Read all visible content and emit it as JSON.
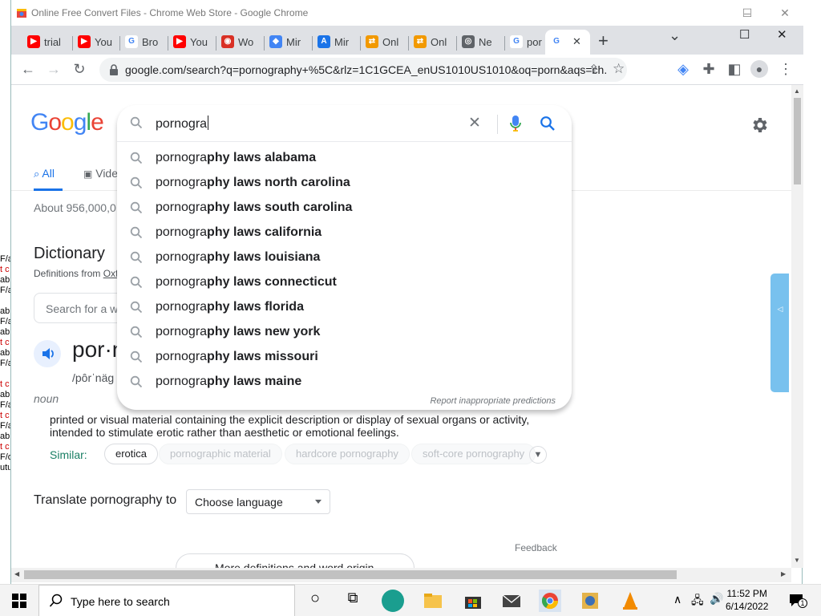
{
  "desktop_left_fragments": [
    "F/a",
    "t c",
    "abl",
    "F/a",
    "abl",
    "F/a",
    "abl",
    "t c",
    "abl",
    "F/a",
    "t c",
    "abl",
    "F/a",
    "t c",
    "F/a",
    "abl",
    "t c",
    "F/o",
    "utu"
  ],
  "window": {
    "title": "Online Free Convert Files - Chrome Web Store - Google Chrome",
    "minimize": "–",
    "maximize": "☐",
    "close": "✕"
  },
  "tabs": [
    {
      "label": "trial",
      "favicon": "youtube-icon",
      "color": "#ff0000",
      "glyph": "▶"
    },
    {
      "label": "You",
      "favicon": "youtube-icon",
      "color": "#ff0000",
      "glyph": "▶"
    },
    {
      "label": "Bro",
      "favicon": "google-icon",
      "color": "#ffffff",
      "glyph": "G"
    },
    {
      "label": "You",
      "favicon": "youtube-icon",
      "color": "#ff0000",
      "glyph": "▶"
    },
    {
      "label": "Wo",
      "favicon": "owl-icon",
      "color": "#d93025",
      "glyph": "◉"
    },
    {
      "label": "Mir",
      "favicon": "app-icon",
      "color": "#4285f4",
      "glyph": "◆"
    },
    {
      "label": "Mir",
      "favicon": "app-store-icon",
      "color": "#1a73e8",
      "glyph": "A"
    },
    {
      "label": "Onl",
      "favicon": "convert-icon",
      "color": "#f29900",
      "glyph": "⇄"
    },
    {
      "label": "Onl",
      "favicon": "convert-icon",
      "color": "#f29900",
      "glyph": "⇄"
    },
    {
      "label": "Ne",
      "favicon": "chrome-icon",
      "color": "#5f6368",
      "glyph": "◎"
    },
    {
      "label": "por",
      "favicon": "google-icon",
      "color": "#ffffff",
      "glyph": "G"
    },
    {
      "label": "",
      "favicon": "google-icon",
      "color": "#ffffff",
      "glyph": "G",
      "active": true
    }
  ],
  "new_tab": "+",
  "tab_search": "⌄",
  "tab_close": "✕",
  "toolbar": {
    "url": "google.com/search?q=pornography+%5C&rlz=1C1GCEA_enUS1010US1010&oq=porn&aqs=ch..."
  },
  "google": {
    "logo": [
      "G",
      "o",
      "o",
      "g",
      "l",
      "e"
    ],
    "logo_colors": [
      "#4285f4",
      "#ea4335",
      "#fbbc05",
      "#4285f4",
      "#34a853",
      "#ea4335"
    ]
  },
  "search": {
    "query": "pornogra",
    "suggestions": [
      {
        "prefix": "pornogra",
        "completion": "phy laws alabama"
      },
      {
        "prefix": "pornogra",
        "completion": "phy laws north carolina"
      },
      {
        "prefix": "pornogra",
        "completion": "phy laws south carolina"
      },
      {
        "prefix": "pornogra",
        "completion": "phy laws california"
      },
      {
        "prefix": "pornogra",
        "completion": "phy laws louisiana"
      },
      {
        "prefix": "pornogra",
        "completion": "phy laws connecticut"
      },
      {
        "prefix": "pornogra",
        "completion": "phy laws florida"
      },
      {
        "prefix": "pornogra",
        "completion": "phy laws new york"
      },
      {
        "prefix": "pornogra",
        "completion": "phy laws missouri"
      },
      {
        "prefix": "pornogra",
        "completion": "phy laws maine"
      }
    ],
    "report": "Report inappropriate predictions"
  },
  "results": {
    "tabs": [
      {
        "label": "All",
        "active": true
      },
      {
        "label": "Vide",
        "active": false
      }
    ],
    "stats": "About 956,000,0",
    "dictionary_title": "Dictionary",
    "definitions_from": "Definitions from ",
    "definitions_source": "Oxf",
    "word_search_placeholder": "Search for a w",
    "headword": "por·n",
    "phonetic": "/pôrˈnäg",
    "part_of_speech": "noun",
    "definition": "printed or visual material containing the explicit description or display of sexual organs or activity, intended to stimulate erotic rather than aesthetic or emotional feelings.",
    "similar_label": "Similar:",
    "similar": [
      "erotica",
      "pornographic material",
      "hardcore pornography",
      "soft-core pornography"
    ],
    "translate_label": "Translate pornography to",
    "language_select": "Choose language",
    "feedback": "Feedback",
    "more_definitions": "More definitions and word origin"
  },
  "taskbar": {
    "search_placeholder": "Type here to search",
    "time": "11:52 PM",
    "date": "6/14/2022",
    "notifications": "1"
  }
}
